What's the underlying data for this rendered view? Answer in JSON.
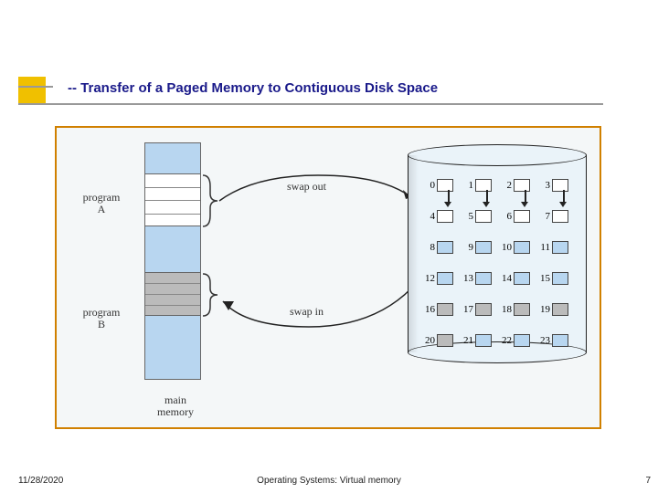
{
  "title": "-- Transfer of a Paged Memory to Contiguous Disk Space",
  "labels": {
    "programA": "program\nA",
    "programB": "program\nB",
    "main_memory": "main\nmemory",
    "swap_out": "swap out",
    "swap_in": "swap in"
  },
  "disk_blocks": [
    {
      "n": 0,
      "fill": "white"
    },
    {
      "n": 1,
      "fill": "white"
    },
    {
      "n": 2,
      "fill": "white"
    },
    {
      "n": 3,
      "fill": "white"
    },
    {
      "n": 4,
      "fill": "white"
    },
    {
      "n": 5,
      "fill": "white"
    },
    {
      "n": 6,
      "fill": "white"
    },
    {
      "n": 7,
      "fill": "white"
    },
    {
      "n": 8,
      "fill": "blue"
    },
    {
      "n": 9,
      "fill": "blue"
    },
    {
      "n": 10,
      "fill": "blue"
    },
    {
      "n": 11,
      "fill": "blue"
    },
    {
      "n": 12,
      "fill": "blue"
    },
    {
      "n": 13,
      "fill": "blue"
    },
    {
      "n": 14,
      "fill": "blue"
    },
    {
      "n": 15,
      "fill": "blue"
    },
    {
      "n": 16,
      "fill": "gray"
    },
    {
      "n": 17,
      "fill": "gray"
    },
    {
      "n": 18,
      "fill": "gray"
    },
    {
      "n": 19,
      "fill": "gray"
    },
    {
      "n": 20,
      "fill": "gray"
    },
    {
      "n": 21,
      "fill": "blue"
    },
    {
      "n": 22,
      "fill": "blue"
    },
    {
      "n": 23,
      "fill": "blue"
    }
  ],
  "footer": {
    "date": "11/28/2020",
    "center": "Operating Systems: Virtual memory",
    "page": "7"
  }
}
